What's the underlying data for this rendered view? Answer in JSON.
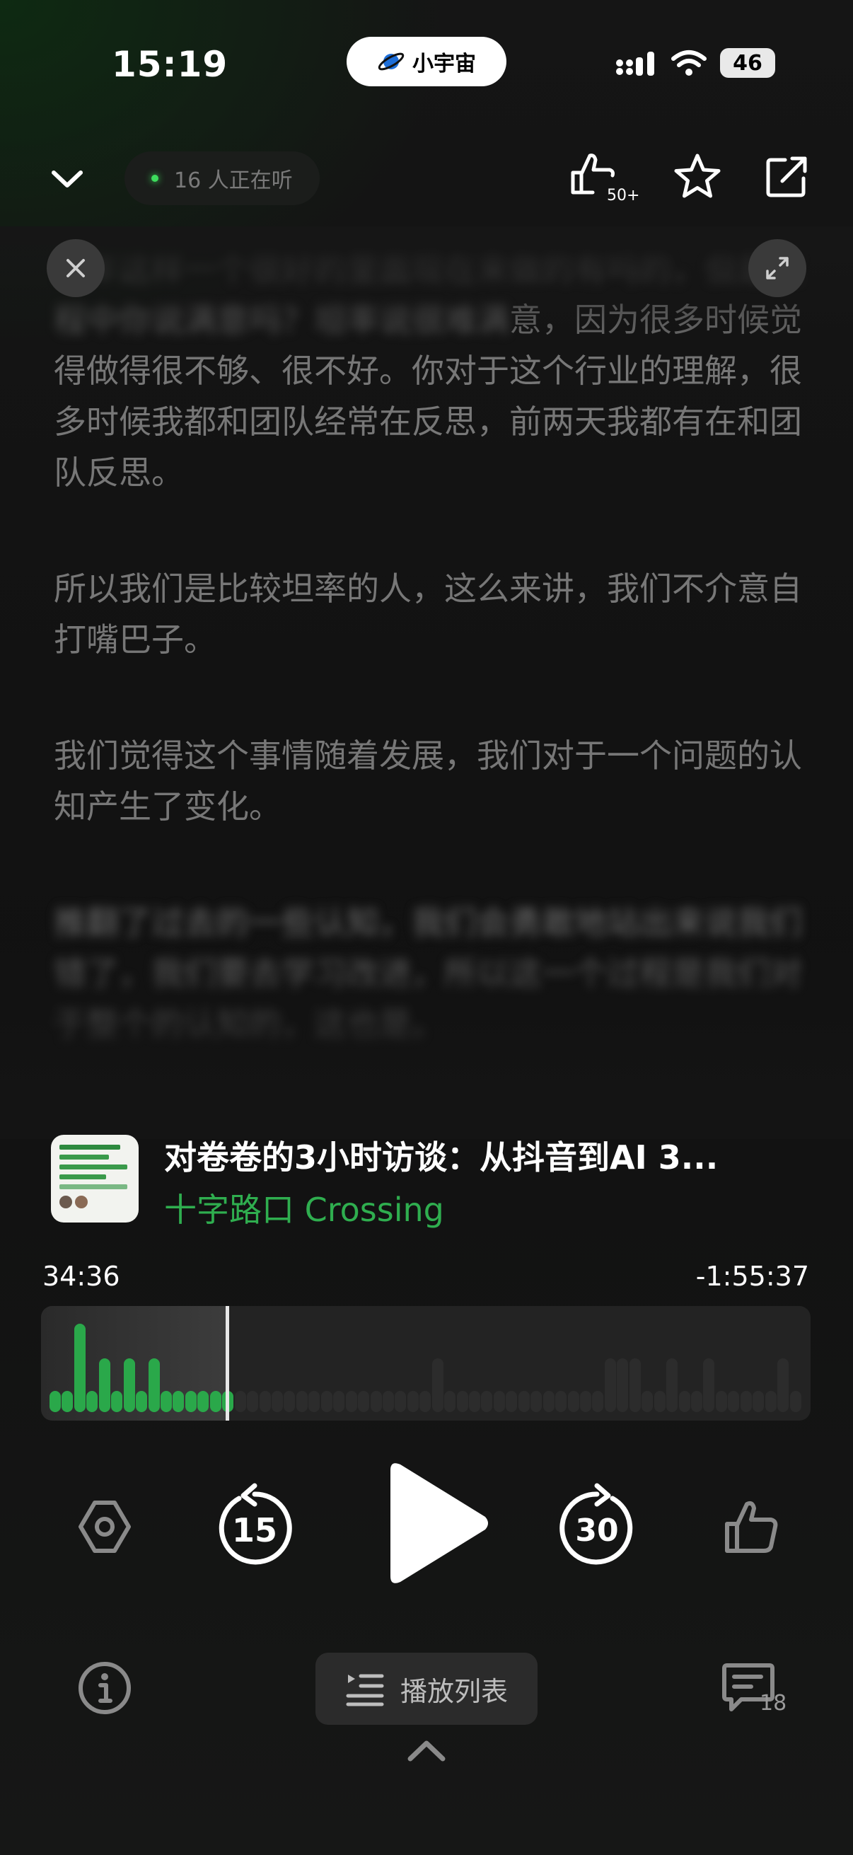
{
  "status_bar": {
    "time": "15:19",
    "island_label": "小宇宙",
    "battery": "46",
    "icons": [
      "planet-icon",
      "signal-icon",
      "wifi-icon",
      "battery-icon"
    ]
  },
  "header": {
    "listening_text": "16 人正在听",
    "like_count": "50+",
    "icons": [
      "chevron-down-icon",
      "thumbs-up-icon",
      "star-icon",
      "share-icon"
    ]
  },
  "transcript": {
    "paragraphs": [
      {
        "blur_text": "去年这样一个很好的里面现在来做的有吗的，但是过程中你说满意吗？坦率说很难满",
        "text": "意，因为很多时候觉得做得很不够、很不好。你对于这个行业的理解，很多时候我都和团队经常在反思，前两天我都有在和团队反思。"
      },
      {
        "text": "所以我们是比较坦率的人，这么来讲，我们不介意自打嘴巴子。"
      },
      {
        "text": "我们觉得这个事情随着发展，我们对于一个问题的认知产生了变化。"
      },
      {
        "blur_text": "推翻了过去的一些认知，我们会勇敢地站出来说我们错了，我们要去学习改进，所以这一个过程是我们对于整个的认知的，这也是。"
      }
    ]
  },
  "episode": {
    "title": "对卷卷的3小时访谈：从抖音到AI 3...",
    "podcast": "十字路口 Crossing",
    "cover_lines": [
      "对卷卷的3小时访谈",
      "从抖音到AI 3D",
      "成为独角兽的野心",
      "在自我的边界"
    ]
  },
  "progress": {
    "elapsed": "34:36",
    "remaining": "-1:55:37",
    "played_fraction": 0.24,
    "waveform_levels": [
      0.18,
      0.22,
      0.92,
      0.2,
      0.56,
      0.22,
      0.56,
      0.2,
      0.56,
      0.2,
      0.22,
      0.2,
      0.2,
      0.2,
      0.2,
      0.2,
      0.2,
      0.2,
      0.2,
      0.2,
      0.2,
      0.2,
      0.2,
      0.2,
      0.2,
      0.2,
      0.2,
      0.2,
      0.2,
      0.2,
      0.2,
      0.56,
      0.2,
      0.2,
      0.2,
      0.2,
      0.2,
      0.2,
      0.2,
      0.2,
      0.2,
      0.2,
      0.2,
      0.2,
      0.2,
      0.56,
      0.56,
      0.56,
      0.2,
      0.2,
      0.56,
      0.2,
      0.2,
      0.56,
      0.2,
      0.2,
      0.2,
      0.2,
      0.2,
      0.56,
      0.2
    ],
    "played_color": "#2aa84a",
    "unplayed_color": "#2c2c2c"
  },
  "controls": {
    "rewind_seconds": "15",
    "forward_seconds": "30",
    "icons": [
      "settings-icon",
      "rewind-15-icon",
      "play-icon",
      "forward-30-icon",
      "thumbs-up-icon"
    ]
  },
  "bottom_bar": {
    "playlist_label": "播放列表",
    "comment_count": "18",
    "icons": [
      "info-icon",
      "playlist-icon",
      "comment-icon",
      "chevron-up-icon"
    ]
  },
  "colors": {
    "accent": "#2fae4f",
    "background": "#141414"
  }
}
